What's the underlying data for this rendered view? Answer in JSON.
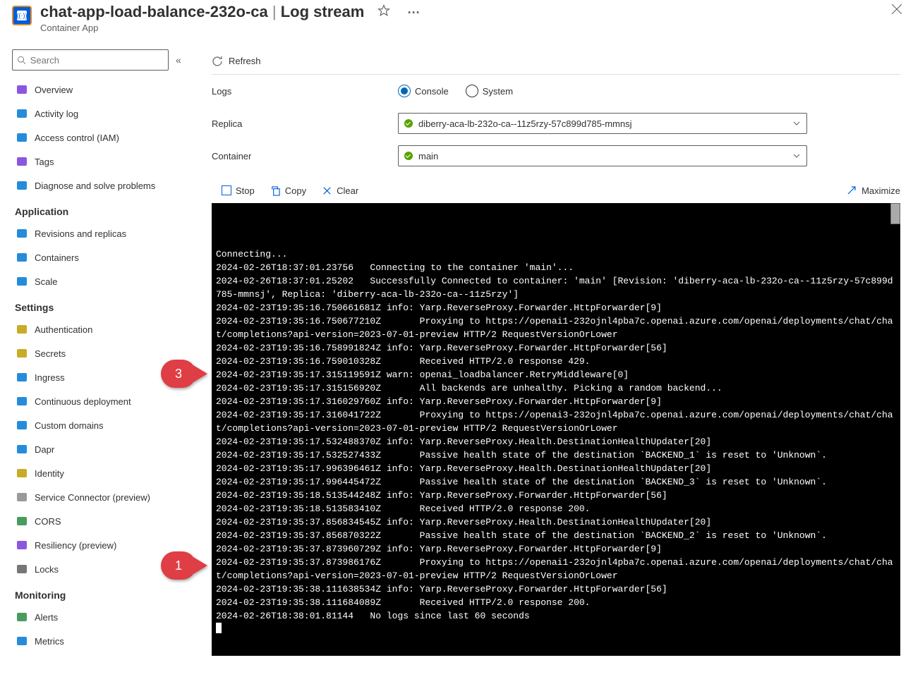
{
  "header": {
    "title_left": "chat-app-load-balance-232o-ca",
    "title_right": "Log stream",
    "subtitle": "Container App"
  },
  "search": {
    "placeholder": "Search"
  },
  "nav_top": [
    {
      "label": "Overview",
      "icon": "overview-icon",
      "color": "#773adc"
    },
    {
      "label": "Activity log",
      "icon": "log-icon",
      "color": "#0078d4"
    },
    {
      "label": "Access control (IAM)",
      "icon": "people-icon",
      "color": "#0078d4"
    },
    {
      "label": "Tags",
      "icon": "tag-icon",
      "color": "#773adc"
    },
    {
      "label": "Diagnose and solve problems",
      "icon": "diagnose-icon",
      "color": "#0078d4"
    }
  ],
  "sections": [
    {
      "title": "Application",
      "items": [
        {
          "label": "Revisions and replicas",
          "icon": "revisions-icon",
          "color": "#0078d4"
        },
        {
          "label": "Containers",
          "icon": "containers-icon",
          "color": "#0078d4"
        },
        {
          "label": "Scale",
          "icon": "scale-icon",
          "color": "#0078d4"
        }
      ]
    },
    {
      "title": "Settings",
      "items": [
        {
          "label": "Authentication",
          "icon": "auth-icon",
          "color": "#c19c00"
        },
        {
          "label": "Secrets",
          "icon": "lock-icon",
          "color": "#c19c00"
        },
        {
          "label": "Ingress",
          "icon": "ingress-icon",
          "color": "#0078d4"
        },
        {
          "label": "Continuous deployment",
          "icon": "deploy-icon",
          "color": "#0078d4"
        },
        {
          "label": "Custom domains",
          "icon": "domains-icon",
          "color": "#0078d4"
        },
        {
          "label": "Dapr",
          "icon": "dapr-icon",
          "color": "#0078d4"
        },
        {
          "label": "Identity",
          "icon": "identity-icon",
          "color": "#c19c00"
        },
        {
          "label": "Service Connector (preview)",
          "icon": "connector-icon",
          "color": "#888888"
        },
        {
          "label": "CORS",
          "icon": "cors-icon",
          "color": "#2a8a43"
        },
        {
          "label": "Resiliency (preview)",
          "icon": "resiliency-icon",
          "color": "#773adc"
        },
        {
          "label": "Locks",
          "icon": "locks-icon",
          "color": "#605e5c"
        }
      ]
    },
    {
      "title": "Monitoring",
      "items": [
        {
          "label": "Alerts",
          "icon": "alerts-icon",
          "color": "#2a8a43"
        },
        {
          "label": "Metrics",
          "icon": "metrics-icon",
          "color": "#0078d4"
        }
      ]
    }
  ],
  "main": {
    "refresh": "Refresh",
    "logs_label": "Logs",
    "radio_console": "Console",
    "radio_system": "System",
    "replica_label": "Replica",
    "replica_value": "diberry-aca-lb-232o-ca--11z5rzy-57c899d785-mmnsj",
    "container_label": "Container",
    "container_value": "main",
    "toolbar": {
      "stop": "Stop",
      "copy": "Copy",
      "clear": "Clear",
      "maximize": "Maximize"
    }
  },
  "markers": {
    "m3": "3",
    "m1": "1"
  },
  "log_lines": [
    "Connecting...",
    "2024-02-26T18:37:01.23756   Connecting to the container 'main'...",
    "2024-02-26T18:37:01.25202   Successfully Connected to container: 'main' [Revision: 'diberry-aca-lb-232o-ca--11z5rzy-57c899d785-mmnsj', Replica: 'diberry-aca-lb-232o-ca--11z5rzy']",
    "2024-02-23T19:35:16.750661681Z info: Yarp.ReverseProxy.Forwarder.HttpForwarder[9]",
    "2024-02-23T19:35:16.750677210Z       Proxying to https://openai1-232ojnl4pba7c.openai.azure.com/openai/deployments/chat/chat/completions?api-version=2023-07-01-preview HTTP/2 RequestVersionOrLower",
    "2024-02-23T19:35:16.758991824Z info: Yarp.ReverseProxy.Forwarder.HttpForwarder[56]",
    "2024-02-23T19:35:16.759010328Z       Received HTTP/2.0 response 429.",
    "2024-02-23T19:35:17.315119591Z warn: openai_loadbalancer.RetryMiddleware[0]",
    "2024-02-23T19:35:17.315156920Z       All backends are unhealthy. Picking a random backend...",
    "2024-02-23T19:35:17.316029760Z info: Yarp.ReverseProxy.Forwarder.HttpForwarder[9]",
    "2024-02-23T19:35:17.316041722Z       Proxying to https://openai3-232ojnl4pba7c.openai.azure.com/openai/deployments/chat/chat/completions?api-version=2023-07-01-preview HTTP/2 RequestVersionOrLower",
    "2024-02-23T19:35:17.532488370Z info: Yarp.ReverseProxy.Health.DestinationHealthUpdater[20]",
    "2024-02-23T19:35:17.532527433Z       Passive health state of the destination `BACKEND_1` is reset to 'Unknown`.",
    "2024-02-23T19:35:17.996396461Z info: Yarp.ReverseProxy.Health.DestinationHealthUpdater[20]",
    "2024-02-23T19:35:17.996445472Z       Passive health state of the destination `BACKEND_3` is reset to 'Unknown`.",
    "2024-02-23T19:35:18.513544248Z info: Yarp.ReverseProxy.Forwarder.HttpForwarder[56]",
    "2024-02-23T19:35:18.513583410Z       Received HTTP/2.0 response 200.",
    "2024-02-23T19:35:37.856834545Z info: Yarp.ReverseProxy.Health.DestinationHealthUpdater[20]",
    "2024-02-23T19:35:37.856870322Z       Passive health state of the destination `BACKEND_2` is reset to 'Unknown`.",
    "2024-02-23T19:35:37.873960729Z info: Yarp.ReverseProxy.Forwarder.HttpForwarder[9]",
    "2024-02-23T19:35:37.873986176Z       Proxying to https://openai1-232ojnl4pba7c.openai.azure.com/openai/deployments/chat/chat/completions?api-version=2023-07-01-preview HTTP/2 RequestVersionOrLower",
    "2024-02-23T19:35:38.111638534Z info: Yarp.ReverseProxy.Forwarder.HttpForwarder[56]",
    "2024-02-23T19:35:38.111684089Z       Received HTTP/2.0 response 200.",
    "2024-02-26T18:38:01.81144   No logs since last 60 seconds"
  ]
}
